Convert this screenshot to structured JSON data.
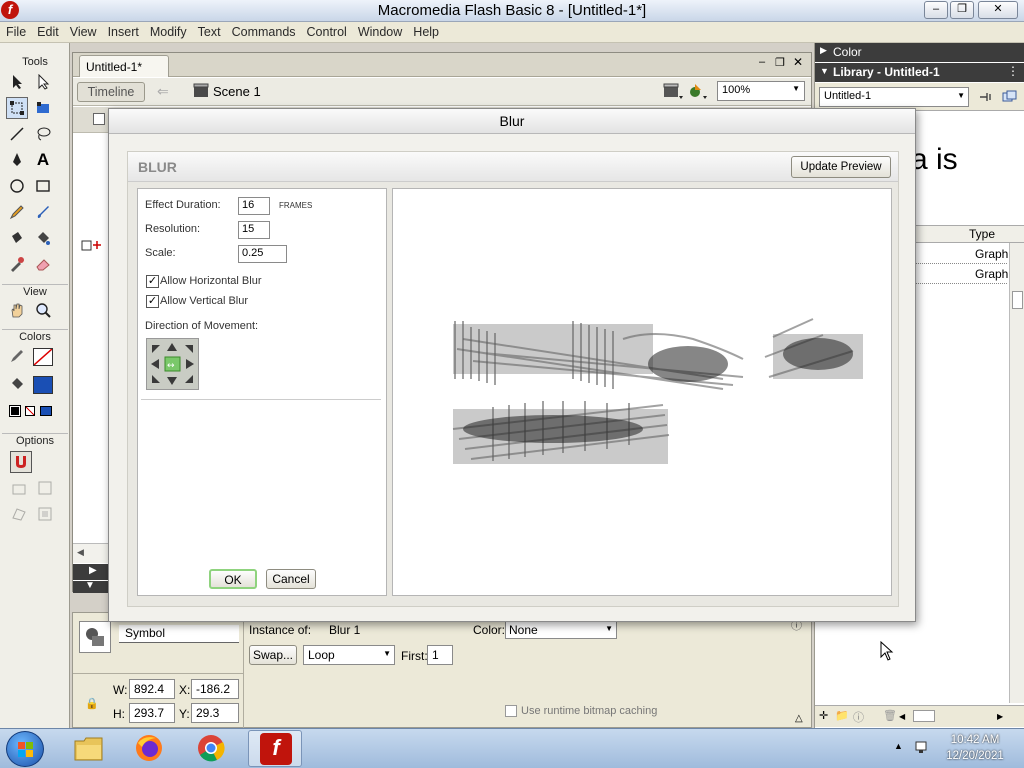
{
  "window": {
    "title": "Macromedia Flash Basic 8 - [Untitled-1*]"
  },
  "menubar": [
    "File",
    "Edit",
    "View",
    "Insert",
    "Modify",
    "Text",
    "Commands",
    "Control",
    "Window",
    "Help"
  ],
  "tools": {
    "header": "Tools",
    "view_header": "View",
    "colors_header": "Colors",
    "options_header": "Options"
  },
  "document": {
    "tab": "Untitled-1*",
    "timeline_button": "Timeline",
    "scene": "Scene 1",
    "zoom": "100%"
  },
  "properties": {
    "symbol_label": "Symbol",
    "instance_of_label": "Instance of:",
    "instance_of_value": "Blur 1",
    "color_label": "Color:",
    "color_value": "None",
    "swap_button": "Swap...",
    "loop_value": "Loop",
    "first_label": "First:",
    "first_value": "1",
    "w_label": "W:",
    "w_value": "892.4",
    "x_label": "X:",
    "x_value": "-186.2",
    "h_label": "H:",
    "h_value": "293.7",
    "y_label": "Y:",
    "y_value": "29.3",
    "bitmap_caching": "Use runtime bitmap caching"
  },
  "right_panel": {
    "color_header": "Color",
    "library_header": "Library - Untitled-1",
    "library_select": "Untitled-1",
    "stage_text": "a is",
    "type_header": "Type",
    "rows": [
      "Graph",
      "Graph"
    ]
  },
  "dialog": {
    "title": "Blur",
    "header": "BLUR",
    "update_preview": "Update Preview",
    "effect_duration_label": "Effect Duration:",
    "effect_duration_value": "16",
    "frames_label": "FRAMES",
    "resolution_label": "Resolution:",
    "resolution_value": "15",
    "scale_label": "Scale:",
    "scale_value": "0.25",
    "allow_h_blur": "Allow Horizontal Blur",
    "allow_v_blur": "Allow Vertical Blur",
    "direction_label": "Direction of Movement:",
    "ok": "OK",
    "cancel": "Cancel"
  },
  "taskbar": {
    "time": "10:42 AM",
    "date": "12/20/2021"
  },
  "colors": {
    "accent": "#1a4fb4",
    "flash_red": "#c0140c",
    "taskbar": "#9fbbdc"
  }
}
